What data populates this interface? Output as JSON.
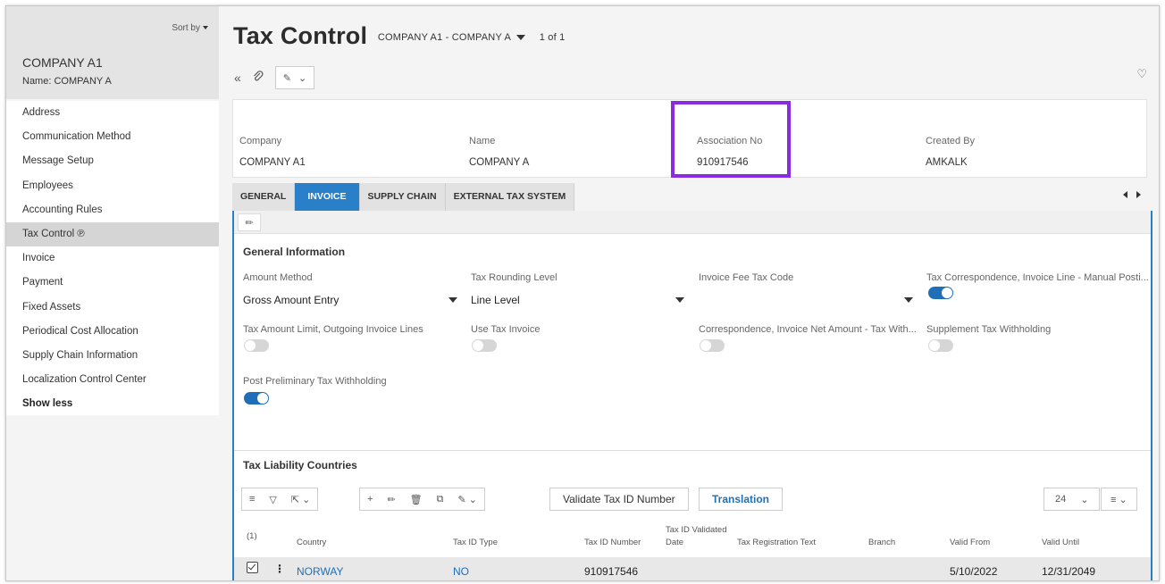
{
  "sidebar": {
    "sort_label": "Sort by",
    "record_title": "COMPANY A1",
    "record_subtitle": "Name:  COMPANY A",
    "items": [
      {
        "label": "Address"
      },
      {
        "label": "Communication Method"
      },
      {
        "label": "Message Setup"
      },
      {
        "label": "Employees"
      },
      {
        "label": "Accounting Rules"
      },
      {
        "label": "Tax Control ℗"
      },
      {
        "label": "Invoice"
      },
      {
        "label": "Payment"
      },
      {
        "label": "Fixed Assets"
      },
      {
        "label": "Periodical Cost Allocation"
      },
      {
        "label": "Supply Chain Information"
      },
      {
        "label": "Localization Control Center"
      },
      {
        "label": "Show less"
      }
    ]
  },
  "header": {
    "title": "Tax Control",
    "record_selector": "COMPANY A1 - COMPANY A",
    "record_count": "1 of 1"
  },
  "header_card": {
    "company_label": "Company",
    "company_value": "COMPANY A1",
    "name_label": "Name",
    "name_value": "COMPANY A",
    "assoc_label": "Association No",
    "assoc_value": "910917546",
    "created_label": "Created By",
    "created_value": "AMKALK"
  },
  "tabs": [
    "GENERAL",
    "INVOICE",
    "SUPPLY CHAIN",
    "EXTERNAL TAX SYSTEM"
  ],
  "general_info": {
    "title": "General Information",
    "amount_method_label": "Amount Method",
    "amount_method_value": "Gross Amount Entry",
    "tax_rounding_label": "Tax Rounding Level",
    "tax_rounding_value": "Line Level",
    "invoice_fee_label": "Invoice Fee Tax Code",
    "invoice_fee_value": "",
    "tax_corr_label": "Tax Correspondence, Invoice Line - Manual Posti...",
    "tax_amount_limit_label": "Tax Amount Limit, Outgoing Invoice Lines",
    "use_tax_invoice_label": "Use Tax Invoice",
    "corr_net_label": "Correspondence, Invoice Net Amount - Tax With...",
    "supp_tax_label": "Supplement Tax Withholding",
    "post_prelim_label": "Post Preliminary Tax Withholding",
    "toggles": {
      "tax_corr": true,
      "tax_amount_limit": false,
      "use_tax_invoice": false,
      "corr_net": false,
      "supp_tax": false,
      "post_prelim": true
    }
  },
  "tax_liability": {
    "title": "Tax Liability Countries",
    "validate_button": "Validate Tax ID Number",
    "translation_button": "Translation",
    "page_size": "24",
    "selected_count": "(1)",
    "columns": {
      "country": "Country",
      "tax_id_type": "Tax ID Type",
      "tax_id_number": "Tax ID Number",
      "tax_id_validated": "Tax ID Validated",
      "date": "Date",
      "reg_text": "Tax Registration Text",
      "branch": "Branch",
      "valid_from": "Valid From",
      "valid_until": "Valid Until"
    },
    "row": {
      "country": "NORWAY",
      "tax_id_type": "NO",
      "tax_id_number": "910917546",
      "valid_from": "5/10/2022",
      "valid_until": "12/31/2049"
    }
  }
}
